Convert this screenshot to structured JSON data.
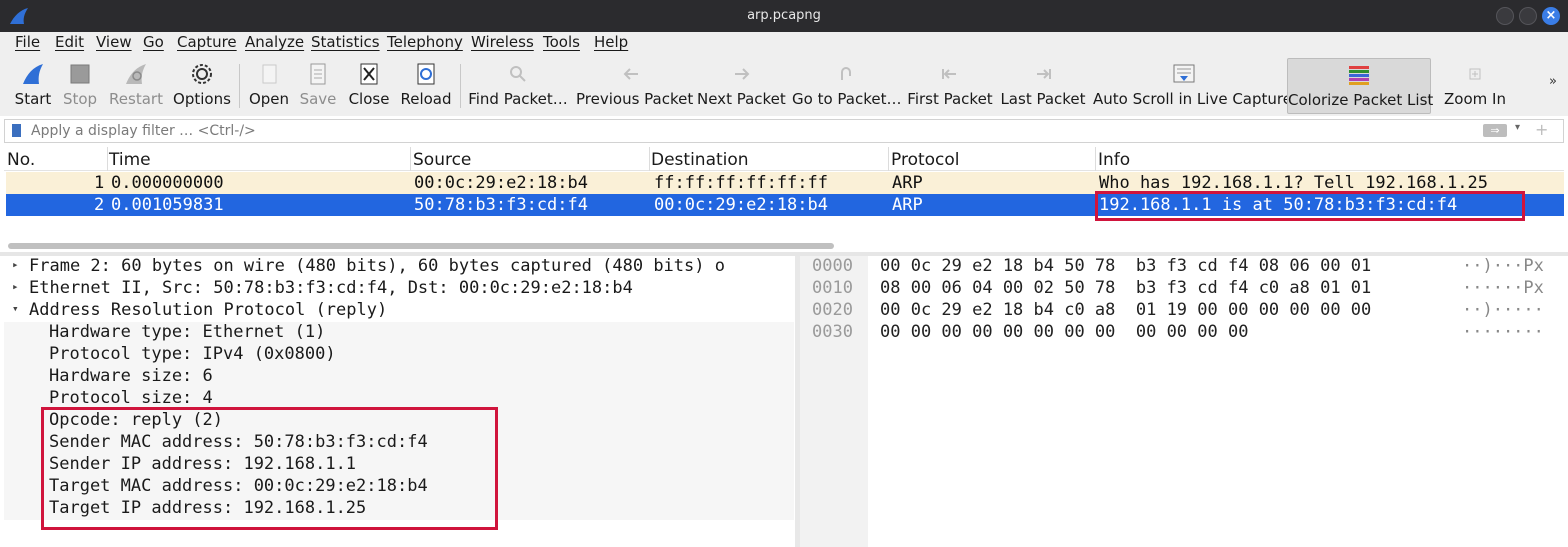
{
  "window": {
    "title": "arp.pcapng",
    "close_glyph": "×"
  },
  "menu": [
    "File",
    "Edit",
    "View",
    "Go",
    "Capture",
    "Analyze",
    "Statistics",
    "Telephony",
    "Wireless",
    "Tools",
    "Help"
  ],
  "toolbar": {
    "start": "Start",
    "stop": "Stop",
    "restart": "Restart",
    "options": "Options",
    "open": "Open",
    "save": "Save",
    "close": "Close",
    "reload": "Reload",
    "find_packet": "Find Packet…",
    "previous_packet": "Previous Packet",
    "next_packet": "Next Packet",
    "go_to_packet": "Go to Packet…",
    "first_packet": "First Packet",
    "last_packet": "Last Packet",
    "auto_scroll": "Auto Scroll in Live Capture",
    "colorize": "Colorize Packet List",
    "zoom_in": "Zoom In",
    "overflow": "»"
  },
  "filter": {
    "placeholder": "Apply a display filter … <Ctrl-/>",
    "apply": "⇒"
  },
  "packet_list": {
    "columns": [
      "No.",
      "Time",
      "Source",
      "Destination",
      "Protocol",
      "Info"
    ],
    "rows": [
      {
        "no": "1",
        "time": "0.000000000",
        "source": "00:0c:29:e2:18:b4",
        "destination": "ff:ff:ff:ff:ff:ff",
        "protocol": "ARP",
        "info": "Who has 192.168.1.1? Tell 192.168.1.25"
      },
      {
        "no": "2",
        "time": "0.001059831",
        "source": "50:78:b3:f3:cd:f4",
        "destination": "00:0c:29:e2:18:b4",
        "protocol": "ARP",
        "info": "192.168.1.1 is at 50:78:b3:f3:cd:f4"
      }
    ]
  },
  "details": {
    "frame": "Frame 2: 60 bytes on wire (480 bits), 60 bytes captured (480 bits) o",
    "ethernet": "Ethernet II, Src: 50:78:b3:f3:cd:f4, Dst: 00:0c:29:e2:18:b4",
    "arp": "Address Resolution Protocol (reply)",
    "fields": [
      "Hardware type: Ethernet (1)",
      "Protocol type: IPv4 (0x0800)",
      "Hardware size: 6",
      "Protocol size: 4",
      "Opcode: reply (2)",
      "Sender MAC address: 50:78:b3:f3:cd:f4",
      "Sender IP address: 192.168.1.1",
      "Target MAC address: 00:0c:29:e2:18:b4",
      "Target IP address: 192.168.1.25"
    ]
  },
  "bytes": [
    {
      "offset": "0000",
      "hex": "00 0c 29 e2 18 b4 50 78  b3 f3 cd f4 08 06 00 01",
      "ascii": "··)···Px"
    },
    {
      "offset": "0010",
      "hex": "08 00 06 04 00 02 50 78  b3 f3 cd f4 c0 a8 01 01",
      "ascii": "······Px"
    },
    {
      "offset": "0020",
      "hex": "00 0c 29 e2 18 b4 c0 a8  01 19 00 00 00 00 00 00",
      "ascii": "··)·····"
    },
    {
      "offset": "0030",
      "hex": "00 00 00 00 00 00 00 00  00 00 00 00",
      "ascii": "········"
    }
  ],
  "colors": {
    "selected_row": "#2266e0",
    "highlight_box": "#d0143c",
    "arp_row": "#faf0d7"
  },
  "icons": [
    "wireshark-fin-icon",
    "shark-fin-start-icon",
    "stop-square-icon",
    "restart-fin-icon",
    "gear-icon",
    "open-doc-icon",
    "save-doc-icon",
    "close-doc-icon",
    "reload-doc-icon",
    "search-icon",
    "arrow-left-icon",
    "arrow-right-icon",
    "goto-icon",
    "first-icon",
    "last-icon",
    "autoscroll-icon",
    "colorize-icon",
    "zoom-in-icon"
  ]
}
